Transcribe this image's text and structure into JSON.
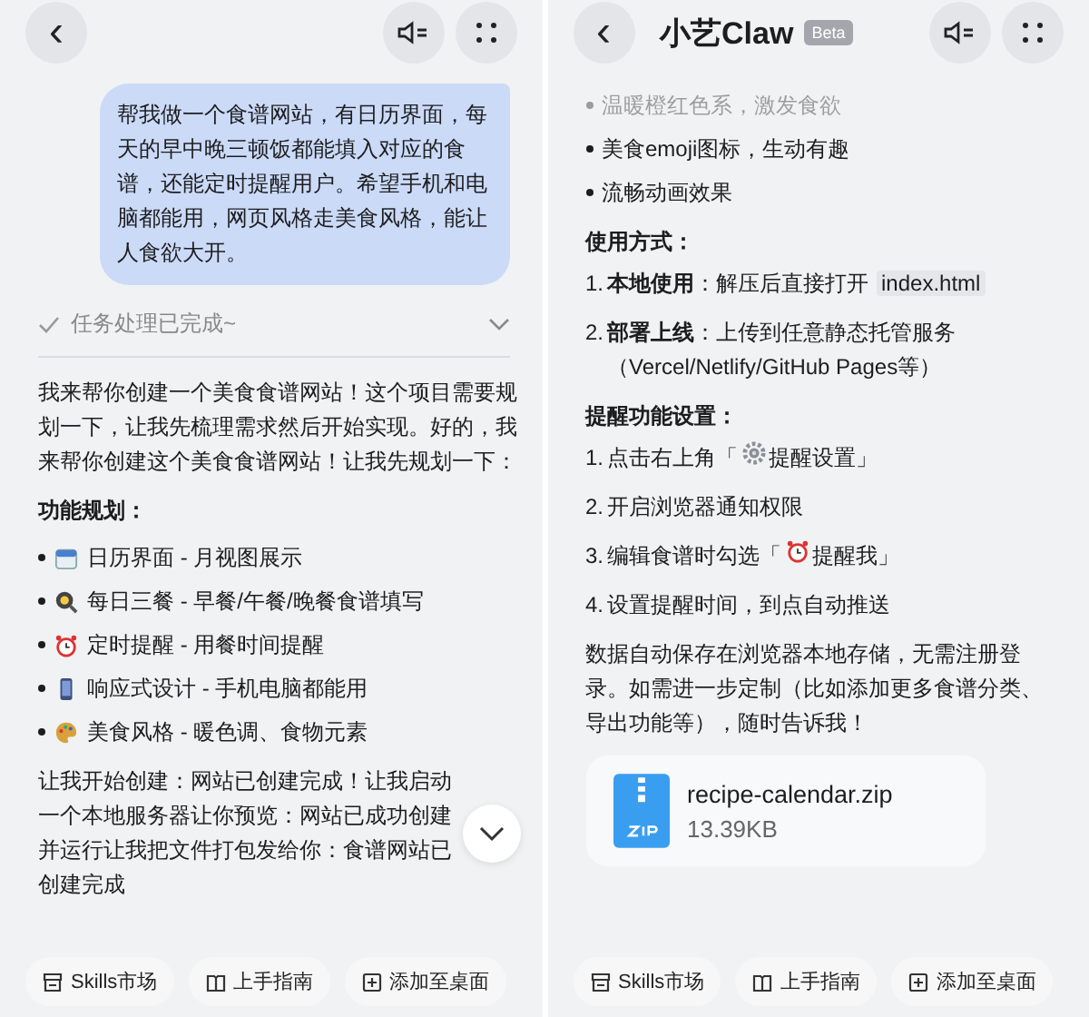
{
  "left": {
    "header": {
      "back": "‹"
    },
    "user_message": "帮我做一个食谱网站，有日历界面，每天的早中晚三顿饭都能填入对应的食谱，还能定时提醒用户。希望手机和电脑都能用，网页风格走美食风格，能让人食欲大开。",
    "task_status": {
      "label": "任务处理已完成~",
      "expanded": false
    },
    "intro": "我来帮你创建一个美食食谱网站！这个项目需要规划一下，让我先梳理需求然后开始实现。好的，我来帮你创建这个美食食谱网站！让我先规划一下：",
    "heading": "功能规划：",
    "bullets": [
      {
        "kind": "calendar",
        "text": "日历界面 - 月视图展示"
      },
      {
        "kind": "pan",
        "text": "每日三餐 - 早餐/午餐/晚餐食谱填写"
      },
      {
        "kind": "clock",
        "text": "定时提醒 - 用餐时间提醒"
      },
      {
        "kind": "phone",
        "text": "响应式设计 - 手机电脑都能用"
      },
      {
        "kind": "palette",
        "text": "美食风格 - 暖色调、食物元素"
      }
    ],
    "closing": "让我开始创建：网站已创建完成！让我启动一个本地服务器让你预览：网站已成功创建并运行让我把文件打包发给你：食谱网站已创建完成",
    "chips": [
      {
        "kind": "store",
        "label": "Skills市场"
      },
      {
        "kind": "book",
        "label": "上手指南"
      },
      {
        "kind": "add",
        "label": "添加至桌面"
      }
    ]
  },
  "right": {
    "header": {
      "title": "小艺Claw",
      "badge": "Beta"
    },
    "faded_bullet": "温暖橙红色系，激发食欲",
    "bullets": [
      "美食emoji图标，生动有趣",
      "流畅动画效果"
    ],
    "usage_heading": "使用方式：",
    "usage": [
      {
        "number": "1.",
        "lead": "本地使用",
        "text": "：解压后直接打开",
        "code": "index.html"
      },
      {
        "number": "2.",
        "lead": "部署上线",
        "text": "：上传到任意静态托管服务（Vercel/Netlify/GitHub Pages等）"
      }
    ],
    "reminder_heading": "提醒功能设置：",
    "reminders": [
      {
        "number": "1.",
        "kind": "gear",
        "before": "点击右上角「",
        "after": "提醒设置」"
      },
      {
        "number": "2.",
        "kind": "plain",
        "before": "开启浏览器通知权限"
      },
      {
        "number": "3.",
        "kind": "clock",
        "before": "编辑食谱时勾选「",
        "after": "提醒我」"
      },
      {
        "number": "4.",
        "kind": "plain",
        "before": "设置提醒时间，到点自动推送"
      }
    ],
    "outro": "数据自动保存在浏览器本地存储，无需注册登录。如需进一步定制（比如添加更多食谱分类、导出功能等），随时告诉我！",
    "file": {
      "name": "recipe-calendar.zip",
      "size": "13.39KB"
    },
    "chips": [
      {
        "kind": "store",
        "label": "Skills市场"
      },
      {
        "kind": "book",
        "label": "上手指南"
      },
      {
        "kind": "add",
        "label": "添加至桌面"
      }
    ]
  }
}
